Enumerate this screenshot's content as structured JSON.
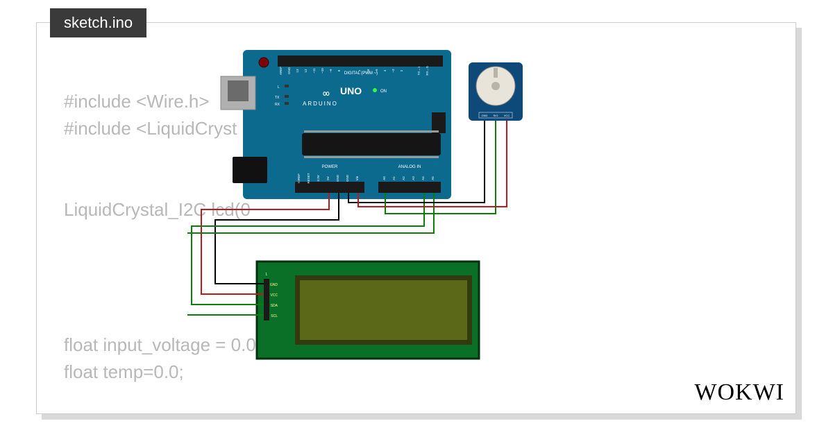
{
  "tab": {
    "label": "sketch.ino"
  },
  "code": {
    "l1": "#include <Wire.h>",
    "l2": "#include <LiquidCryst",
    "l3": "",
    "l4": "",
    "l5": "LiquidCrystal_I2C lcd(0",
    "l6": "",
    "l7": "",
    "l8": "",
    "l9": "",
    "l10": "float input_voltage = 0.0;",
    "l11": "float temp=0.0;"
  },
  "logo": {
    "text": "WOKWI"
  },
  "board": {
    "name": "Arduino UNO",
    "brand": "ARDUINO",
    "model": "UNO",
    "sections": {
      "digital": "DIGITAL (PWM ~)",
      "analog": "ANALOG IN",
      "power": "POWER"
    },
    "on_label": "ON",
    "tx_label": "TX",
    "rx_label": "RX",
    "l_label": "L",
    "digital_pins": [
      "AREF",
      "GND",
      "13",
      "12",
      "~11",
      "~10",
      "~9",
      "8",
      "7",
      "~6",
      "~5",
      "4",
      "~3",
      "2",
      "TX→1",
      "RX←0"
    ],
    "power_pins": [
      "IOREF",
      "RESET",
      "3.3V",
      "5V",
      "GND",
      "GND",
      "Vin"
    ],
    "analog_pins": [
      "A0",
      "A1",
      "A2",
      "A3",
      "A4",
      "A5"
    ]
  },
  "pot": {
    "pins": [
      "GND",
      "SIG",
      "VCC"
    ]
  },
  "lcd": {
    "pins": [
      "GND",
      "VCC",
      "SDA",
      "SCL"
    ],
    "pin1_label": "1"
  },
  "wires": {
    "colors": {
      "vcc": "#c01818",
      "gnd": "#000000",
      "sda": "#0a7d0a",
      "scl": "#0a7d0a",
      "sig": "#0a7d0a"
    }
  }
}
